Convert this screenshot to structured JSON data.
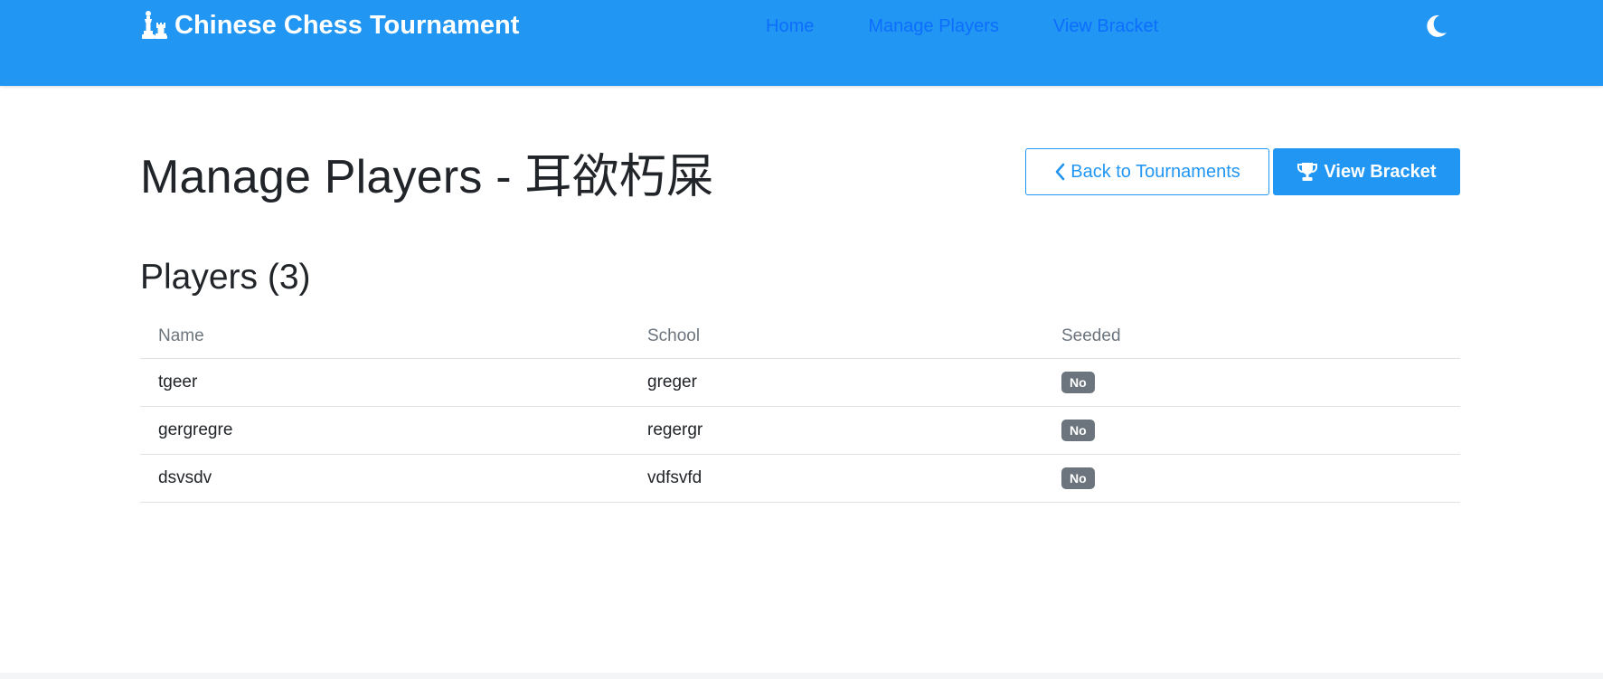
{
  "navbar": {
    "brand_label": "Chinese Chess Tournament",
    "brand_icon": "chess-pieces-icon",
    "links": [
      {
        "label": "Home"
      },
      {
        "label": "Manage Players"
      },
      {
        "label": "View Bracket"
      }
    ],
    "theme_icon": "moon-icon"
  },
  "header": {
    "title": "Manage Players - 耳欲朽屎",
    "back_button_label": "Back to Tournaments",
    "back_button_icon": "chevron-left-icon",
    "bracket_button_label": "View Bracket",
    "bracket_button_icon": "trophy-icon"
  },
  "players": {
    "section_title": "Players (3)",
    "columns": [
      "Name",
      "School",
      "Seeded"
    ],
    "rows": [
      {
        "name": "tgeer",
        "school": "greger",
        "seeded": "No"
      },
      {
        "name": "gergregre",
        "school": "regergr",
        "seeded": "No"
      },
      {
        "name": "dsvsdv",
        "school": "vdfsvfd",
        "seeded": "No"
      }
    ]
  },
  "colors": {
    "primary": "#2196f3",
    "nav_link": "#0d6efd",
    "badge_secondary": "#6c757d"
  }
}
